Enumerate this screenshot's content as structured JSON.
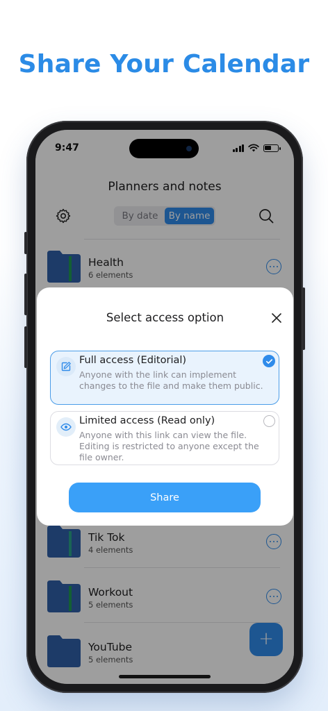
{
  "headline": "Share Your Calendar",
  "status_bar": {
    "time": "9:47"
  },
  "app": {
    "title": "Planners and notes",
    "sort_tabs": [
      "By date",
      "By name"
    ],
    "sort_active": "By name"
  },
  "folders": [
    {
      "name": "Health",
      "count": "6 elements",
      "stripe": "#1f9a55"
    },
    {
      "name": "Tik Tok",
      "count": "4 elements",
      "stripe": "#2aa38a"
    },
    {
      "name": "Workout",
      "count": "5 elements",
      "stripe": "#1f9a55"
    },
    {
      "name": "YouTube",
      "count": "5 elements",
      "stripe": ""
    }
  ],
  "modal": {
    "title": "Select access option",
    "options": [
      {
        "title": "Full access (Editorial)",
        "description": "Anyone with the link can implement changes to the file and make them public.",
        "icon": "edit-icon",
        "selected": true
      },
      {
        "title": "Limited access (Read only)",
        "description": "Anyone with this link can view the file. Editing is restricted to anyone except the file owner.",
        "icon": "eye-icon",
        "selected": false
      }
    ],
    "share_label": "Share"
  },
  "fab_label": "+",
  "colors": {
    "accent": "#2f8bea",
    "headline": "#2b8be6",
    "folder": "#2f5fa8"
  }
}
